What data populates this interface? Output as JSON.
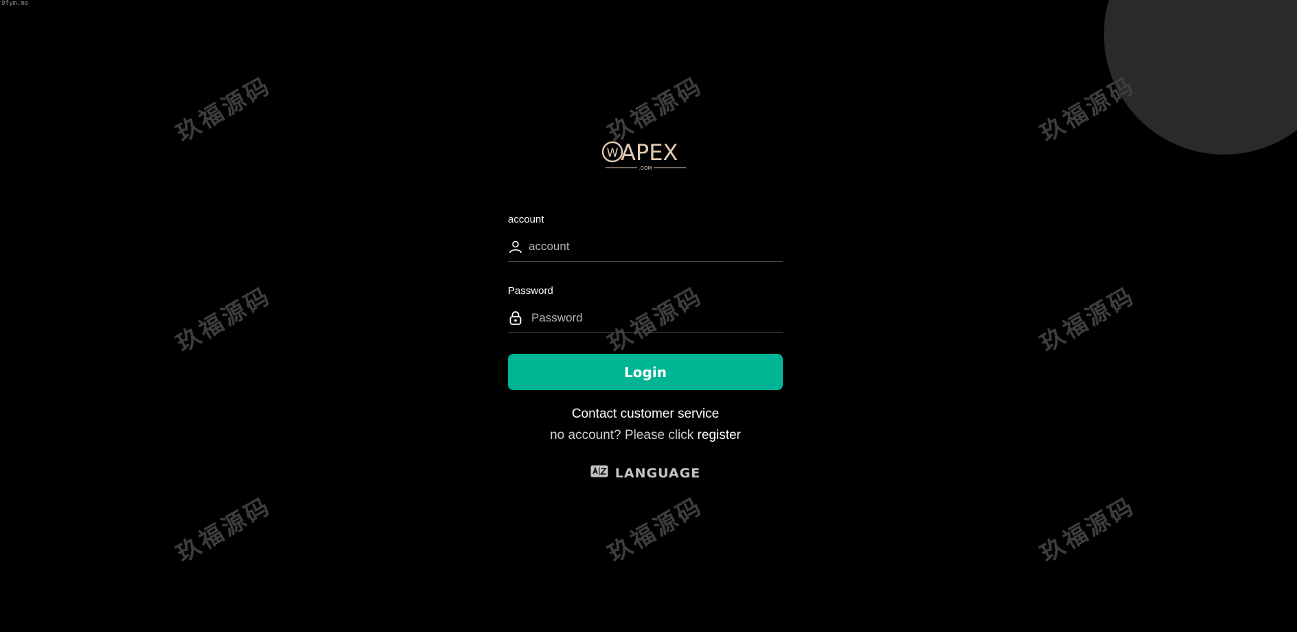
{
  "site_mark": "9fym.me",
  "watermark_text": "玖福源码",
  "logo": {
    "brand": "APEX",
    "suffix": ".COM",
    "badge": "W",
    "color": "#e3cbb4"
  },
  "account": {
    "label": "account",
    "placeholder": "account",
    "icon": "user-icon"
  },
  "password": {
    "label": "Password",
    "placeholder": "Password",
    "icon": "lock-icon"
  },
  "login_button": {
    "label": "Login",
    "color": "#00b594"
  },
  "contact_link": "Contact customer service",
  "register": {
    "prefix": "no account? Please click",
    "link": "register"
  },
  "language": {
    "label": "LANGUAGE",
    "icon": "translate-icon"
  },
  "colors": {
    "background": "#000000",
    "circle": "#2a2a2a",
    "accent": "#00b594"
  }
}
